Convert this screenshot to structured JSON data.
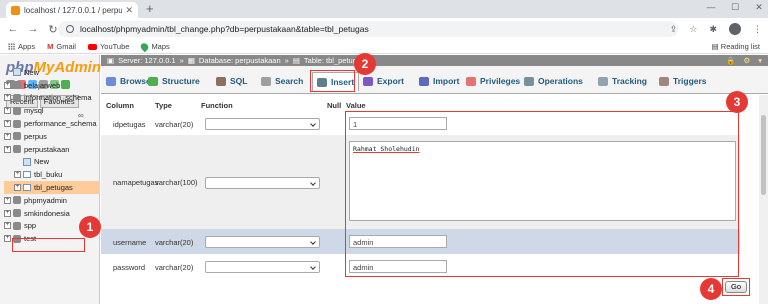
{
  "browser": {
    "tab_title": "localhost / 127.0.0.1 / perpustakaa",
    "url": "localhost/phpmyadmin/tbl_change.php?db=perpustakaan&table=tbl_petugas",
    "bookmarks": [
      {
        "label": "Apps",
        "icon": "apps-grid-icon"
      },
      {
        "label": "Gmail",
        "icon": "gmail-icon"
      },
      {
        "label": "YouTube",
        "icon": "youtube-icon"
      },
      {
        "label": "Maps",
        "icon": "maps-icon"
      }
    ],
    "reading_list": "Reading list"
  },
  "pma": {
    "logo_php": "php",
    "logo_admin": "MyAdmin",
    "tabs": [
      "Recent",
      "Favorites"
    ],
    "tree": [
      {
        "label": "New",
        "kind": "new",
        "level": 0
      },
      {
        "label": "belajarweb",
        "kind": "db",
        "level": 0
      },
      {
        "label": "information_schema",
        "kind": "db",
        "level": 0
      },
      {
        "label": "mysql",
        "kind": "db",
        "level": 0
      },
      {
        "label": "performance_schema",
        "kind": "db",
        "level": 0
      },
      {
        "label": "perpus",
        "kind": "db",
        "level": 0
      },
      {
        "label": "perpustakaan",
        "kind": "db",
        "level": 0
      },
      {
        "label": "New",
        "kind": "new",
        "level": 1
      },
      {
        "label": "tbl_buku",
        "kind": "table",
        "level": 1
      },
      {
        "label": "tbl_petugas",
        "kind": "table",
        "level": 1,
        "selected": true
      },
      {
        "label": "phpmyadmin",
        "kind": "db",
        "level": 0
      },
      {
        "label": "smkindonesia",
        "kind": "db",
        "level": 0
      },
      {
        "label": "spp",
        "kind": "db",
        "level": 0
      },
      {
        "label": "test",
        "kind": "db",
        "level": 0
      }
    ]
  },
  "breadcrumb": {
    "server": "Server: 127.0.0.1",
    "database": "Database: perpustakaan",
    "table": "Table: tbl_petugas"
  },
  "menu": [
    {
      "label": "Browse",
      "color": "#6c8cd5"
    },
    {
      "label": "Structure",
      "color": "#4caf50"
    },
    {
      "label": "SQL",
      "color": "#8d6e63"
    },
    {
      "label": "Search",
      "color": "#9e9e9e"
    },
    {
      "label": "Insert",
      "color": "#607d8b",
      "active": true
    },
    {
      "label": "Export",
      "color": "#7e57c2"
    },
    {
      "label": "Import",
      "color": "#5c6bc0"
    },
    {
      "label": "Privileges",
      "color": "#e57373"
    },
    {
      "label": "Operations",
      "color": "#78909c"
    },
    {
      "label": "Tracking",
      "color": "#90a4ae"
    },
    {
      "label": "Triggers",
      "color": "#a1887f"
    }
  ],
  "table_header": {
    "column": "Column",
    "type": "Type",
    "function": "Function",
    "null": "Null",
    "value": "Value"
  },
  "rows": [
    {
      "column": "idpetugas",
      "type": "varchar(20)",
      "value": "1"
    },
    {
      "column": "namapetugas",
      "type": "varchar(100)",
      "value": "Rahmat Sholehudin"
    },
    {
      "column": "username",
      "type": "varchar(20)",
      "value": "admin"
    },
    {
      "column": "password",
      "type": "varchar(20)",
      "value": "admin"
    }
  ],
  "go_label": "Go",
  "steps": [
    "1",
    "2",
    "3",
    "4"
  ],
  "colors": {
    "annotation_red": "#e53935",
    "pma_link_blue": "#235a81",
    "selected_row": "#ffcc99",
    "highlight_row": "#cfd8e6"
  }
}
